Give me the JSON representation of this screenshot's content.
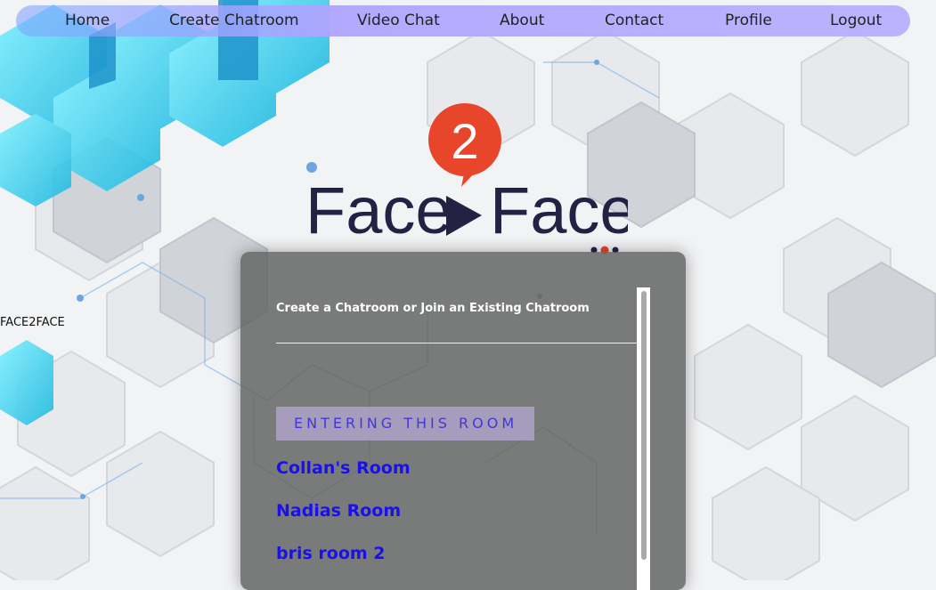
{
  "nav": {
    "items": [
      "Home",
      "Create Chatroom",
      "Video Chat",
      "About",
      "Contact",
      "Profile",
      "Logout"
    ]
  },
  "side_label": "FACE2FACE",
  "logo": {
    "badge_number": "2",
    "left_word": "Face",
    "right_word": "Face",
    "badge_color": "#e8462a",
    "text_color": "#252145"
  },
  "panel": {
    "heading": "Create a Chatroom or Join an Existing Chatroom",
    "entering_label": "ENTERING THIS ROOM",
    "rooms": [
      "Collan's Room",
      "Nadias Room",
      "bris room 2"
    ]
  },
  "colors": {
    "room_link": "#1a10ee",
    "entering_text": "#4536d8",
    "accent_blue": "#3fd0f0"
  }
}
